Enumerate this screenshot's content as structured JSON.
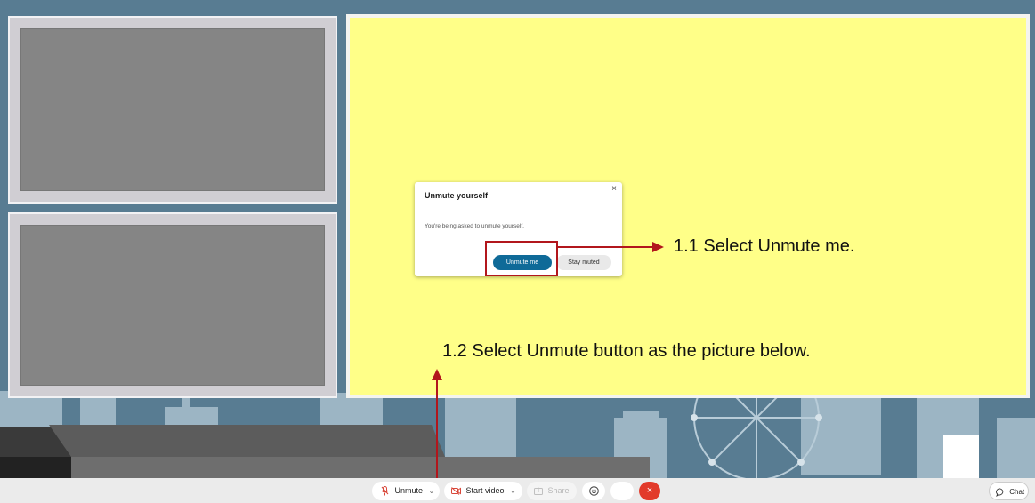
{
  "dialog": {
    "title": "Unmute yourself",
    "close": "×",
    "message": "You're being asked to unmute yourself.",
    "primary_label": "Unmute me",
    "secondary_label": "Stay muted"
  },
  "annotations": {
    "step_1_1": "1.1 Select Unmute me.",
    "step_1_2": "1.2 Select Unmute button as the picture below."
  },
  "toolbar": {
    "unmute_label": "Unmute",
    "video_label": "Start video",
    "share_label": "Share",
    "more_label": "···",
    "leave_label": "×",
    "chat_label": "Chat"
  },
  "colors": {
    "stage_background": "#587c92",
    "shared_content": "#ffff88",
    "primary_button": "#0f6a98",
    "leave_button": "#e23a2a",
    "annotation_red": "#b2161c",
    "video_icon": "#d9473a"
  },
  "icons": {
    "unmute": "microphone-muted-icon",
    "video": "camera-icon",
    "share": "share-icon",
    "reactions": "smiley-icon",
    "more": "more-icon",
    "leave": "close-icon",
    "chat": "chat-bubble-icon"
  }
}
